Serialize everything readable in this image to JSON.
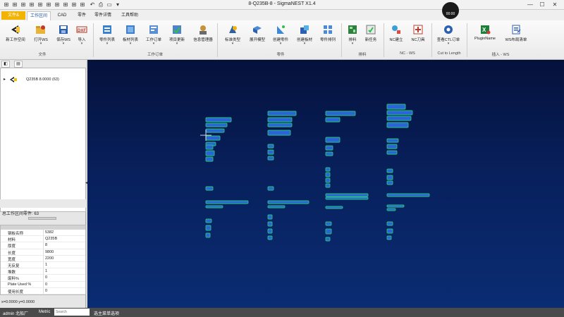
{
  "window": {
    "title": "8-Q235B-8 - SigmaNEST X1.4",
    "clock": "00:00",
    "min_symbol": "—",
    "max_symbol": "☐",
    "close_symbol": "✕"
  },
  "menu": {
    "file_button": "文件&",
    "tabs": [
      "工作区间",
      "CAD",
      "零件",
      "零件详情",
      "工具帮助"
    ],
    "active_tab": "工作区间"
  },
  "ribbon": {
    "buttons": [
      {
        "label": "新工作空间",
        "icon": "new-workspace-icon"
      },
      {
        "label": "打开WS",
        "icon": "open-folder-icon"
      },
      {
        "label": "保存WS",
        "icon": "save-disk-icon"
      },
      {
        "label": "导入",
        "icon": "dxf-import-icon"
      },
      {
        "label": "零件列表",
        "icon": "parts-list-icon"
      },
      {
        "label": "板材列表",
        "icon": "sheets-list-icon"
      },
      {
        "label": "工作订单",
        "icon": "work-order-icon"
      },
      {
        "label": "项目更新",
        "icon": "project-update-icon"
      },
      {
        "label": "信息管理器",
        "icon": "info-manager-icon"
      },
      {
        "label": "标准类型",
        "icon": "standard-shape-icon"
      },
      {
        "label": "展开模型",
        "icon": "unfold-model-icon"
      },
      {
        "label": "创建零件",
        "icon": "create-part-icon"
      },
      {
        "label": "创建板材",
        "icon": "create-sheet-icon"
      },
      {
        "label": "零件排列",
        "icon": "part-array-icon"
      },
      {
        "label": "排料",
        "icon": "nest-icon"
      },
      {
        "label": "新任务",
        "icon": "new-task-icon"
      },
      {
        "label": "NC建立",
        "icon": "nc-build-icon"
      },
      {
        "label": "NC刀具",
        "icon": "nc-tool-icon"
      },
      {
        "label": "查看CTL订单",
        "icon": "ctl-order-icon"
      },
      {
        "label": "PluginName",
        "icon": "plugin-icon"
      },
      {
        "label": "WS布局清单",
        "icon": "ws-layout-list-icon"
      }
    ],
    "groups": [
      "文件",
      "工作订单",
      "零件",
      "排料",
      "NC - WS",
      "Cut to Length",
      "插入 - WS"
    ]
  },
  "left_panel": {
    "tree_item": "Q235B 8.0000 (63)",
    "total_label": "总工作区间零件: 63",
    "properties": [
      {
        "key": "钢板名称",
        "value": "5382"
      },
      {
        "key": "材料",
        "value": "Q235B"
      },
      {
        "key": "厚度",
        "value": "8"
      },
      {
        "key": "长度",
        "value": "9800"
      },
      {
        "key": "宽度",
        "value": "2200"
      },
      {
        "key": "无反复",
        "value": "1"
      },
      {
        "key": "堆数",
        "value": "1"
      },
      {
        "key": "废料%",
        "value": "0"
      },
      {
        "key": "Plate Used %",
        "value": "0"
      },
      {
        "key": "使用长度",
        "value": "0"
      }
    ],
    "coordinates": "x=0.0000 y=0.0000"
  },
  "status": {
    "user": "admin 北船厂",
    "units": "Metric",
    "search_placeholder": "Search",
    "message": "选主菜单选项"
  },
  "colors": {
    "part_fill": "#2a64d6",
    "part_outline": "#25c47a",
    "canvas_top": "#05113b",
    "canvas_bottom": "#0a2c73",
    "file_button": "#f2b400"
  }
}
